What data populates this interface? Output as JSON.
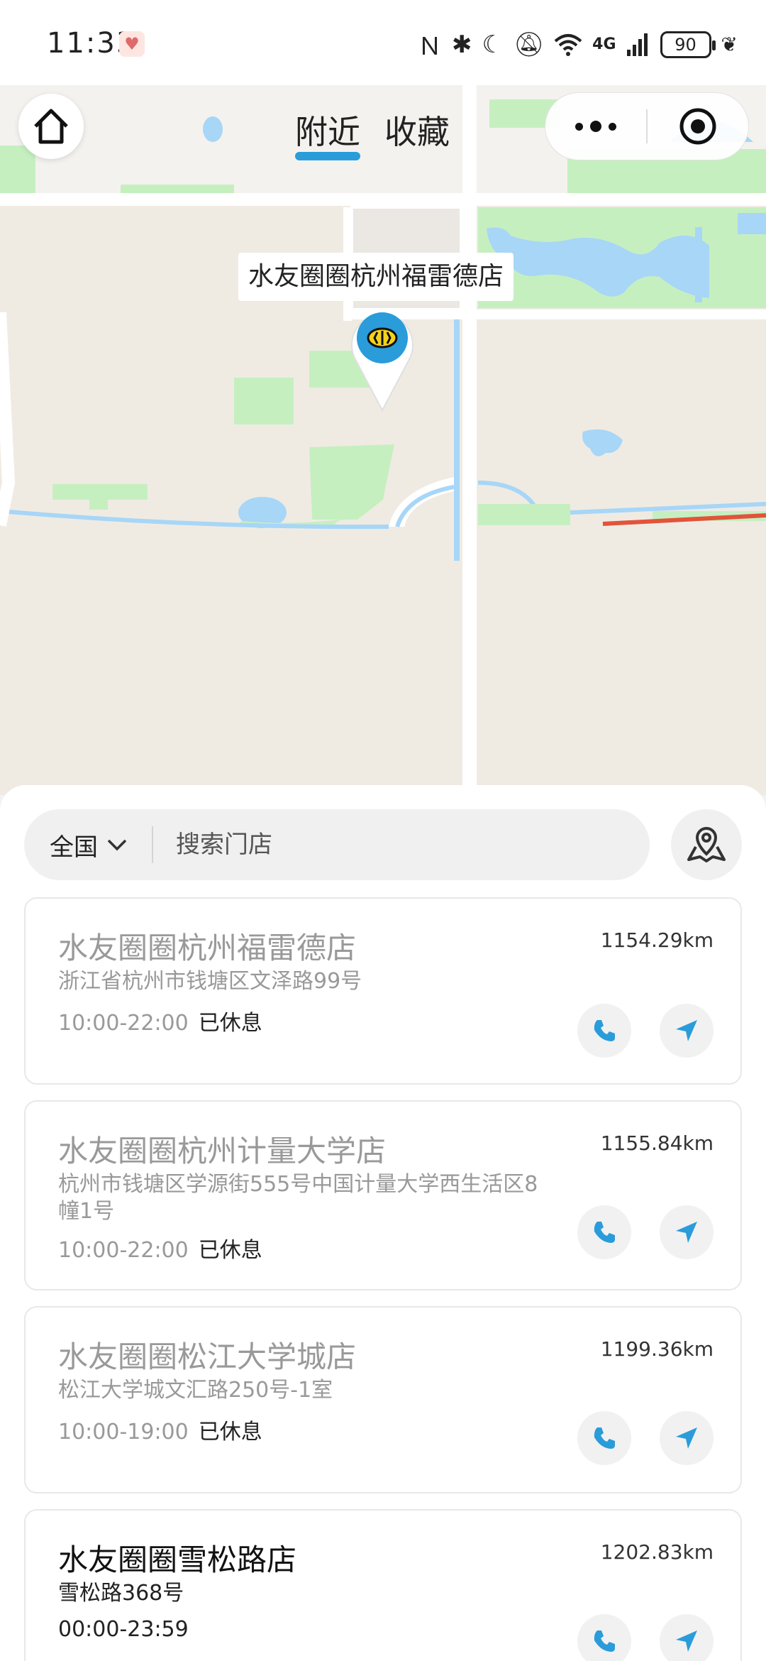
{
  "status_bar": {
    "time": "11:33",
    "network": "4G",
    "battery": "90"
  },
  "map": {
    "tabs": [
      {
        "label": "附近",
        "active": true
      },
      {
        "label": "收藏",
        "active": false
      }
    ],
    "marker_label": "水友圈圈杭州福雷德店",
    "colors": {
      "land": "#efebe3",
      "green": "#c6efc0",
      "water": "#a7d6f7",
      "road": "#ffffff",
      "accent": "#2a9cda"
    }
  },
  "search": {
    "region": "全国",
    "placeholder": "搜索门店"
  },
  "stores": [
    {
      "name": "水友圈圈杭州福雷德店",
      "distance": "1154.29km",
      "address": "浙江省杭州市钱塘区文泽路99号",
      "hours": "10:00-22:00",
      "status": "已休息"
    },
    {
      "name": "水友圈圈杭州计量大学店",
      "distance": "1155.84km",
      "address": "杭州市钱塘区学源街555号中国计量大学西生活区8幢1号",
      "hours": "10:00-22:00",
      "status": "已休息"
    },
    {
      "name": "水友圈圈松江大学城店",
      "distance": "1199.36km",
      "address": "松江大学城文汇路250号-1室",
      "hours": "10:00-19:00",
      "status": "已休息"
    },
    {
      "name": "水友圈圈雪松路店",
      "distance": "1202.83km",
      "address": "雪松路368号",
      "hours": "00:00-23:59",
      "status": ""
    }
  ]
}
